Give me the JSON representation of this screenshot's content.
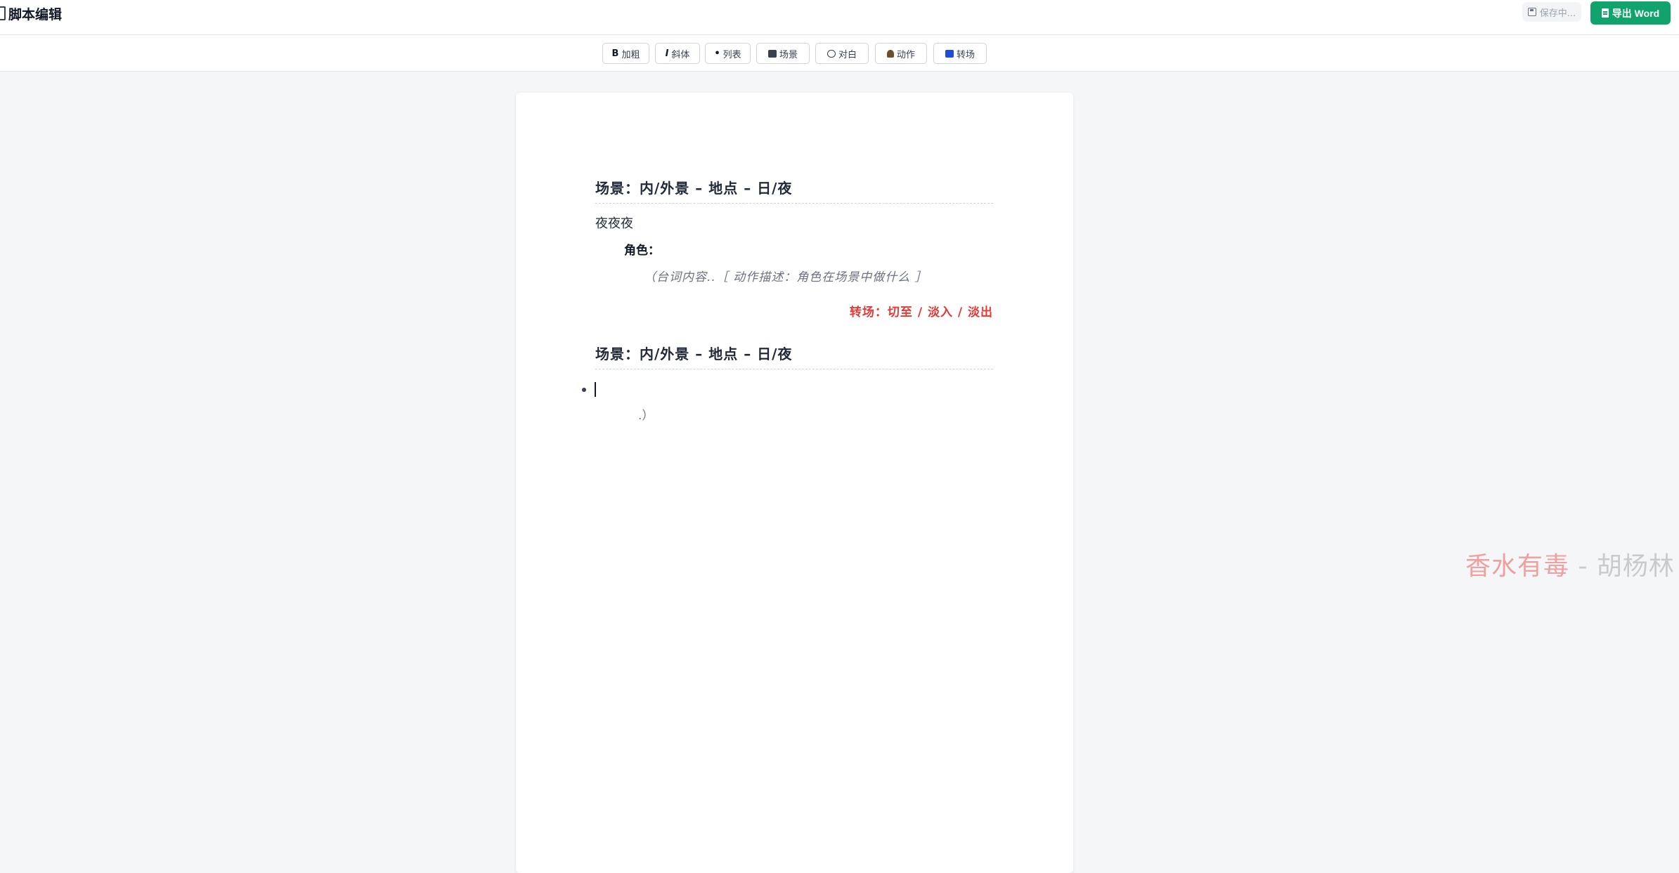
{
  "header": {
    "title": "脚本编辑",
    "save_status": "保存中...",
    "export_label": "导出 Word"
  },
  "toolbar": {
    "items": [
      {
        "glyph": "B",
        "label": "加粗"
      },
      {
        "glyph": "I",
        "label": "斜体"
      },
      {
        "glyph": "•",
        "label": "列表"
      },
      {
        "glyph": "",
        "label": "场景"
      },
      {
        "glyph": "",
        "label": "对白"
      },
      {
        "glyph": "",
        "label": "动作"
      },
      {
        "glyph": "",
        "label": "转场"
      }
    ]
  },
  "document": {
    "scene1": "场景：内/外景 – 地点 – 日/夜",
    "action1": "夜夜夜",
    "character": "角色：",
    "parenthetical": "（台词内容..［ 动作描述：角色在场景中做什么 ］",
    "transition": "转场：切至 / 淡入 / 淡出",
    "scene2": "场景：内/外景 – 地点 – 日/夜",
    "trailing": ".）"
  },
  "watermark": {
    "title": "香水有毒",
    "separator": " - ",
    "author": "胡杨林"
  },
  "colors": {
    "accent_green": "#10a36b",
    "transition_red": "#e53935",
    "background": "#f5f6f8"
  }
}
